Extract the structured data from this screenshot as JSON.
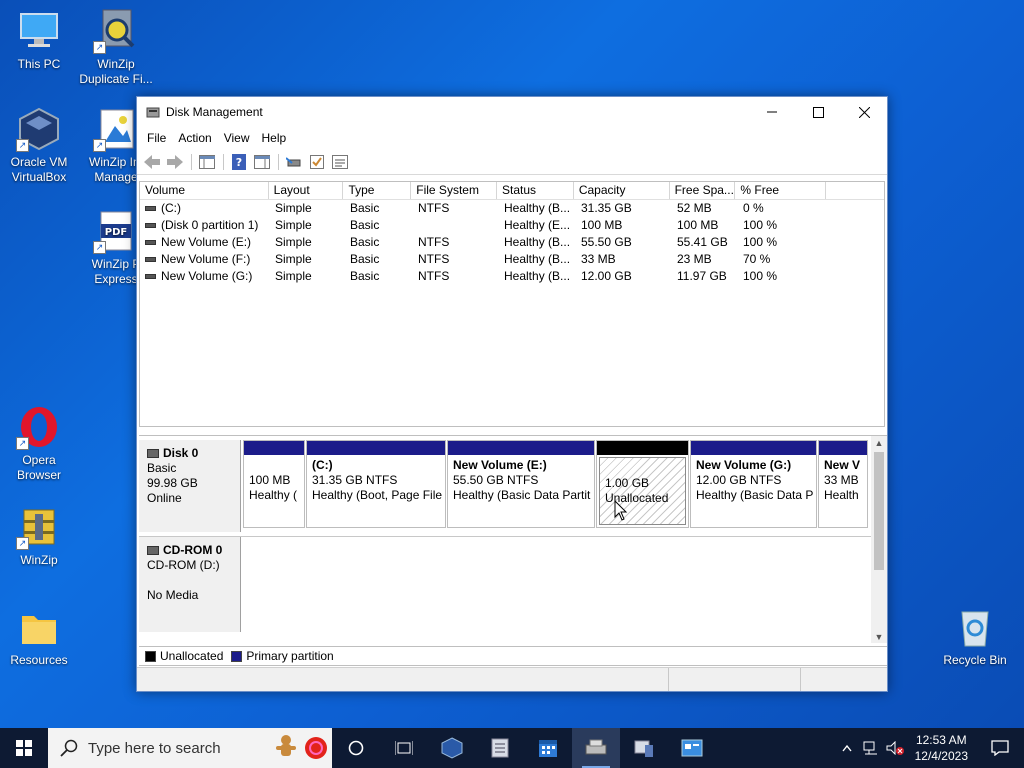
{
  "desktop": {
    "icons": [
      {
        "label": "This PC"
      },
      {
        "label": "WinZip Duplicate Fi..."
      },
      {
        "label": "Oracle VM VirtualBox"
      },
      {
        "label": "WinZip Im Manage"
      },
      {
        "label": "WinZip P Express"
      },
      {
        "label": "Opera Browser"
      },
      {
        "label": "WinZip"
      },
      {
        "label": "Resources"
      },
      {
        "label": "Recycle Bin"
      }
    ]
  },
  "window": {
    "title": "Disk Management",
    "menu": [
      "File",
      "Action",
      "View",
      "Help"
    ]
  },
  "list": {
    "columns": [
      "Volume",
      "Layout",
      "Type",
      "File System",
      "Status",
      "Capacity",
      "Free Spa...",
      "% Free"
    ],
    "rows": [
      [
        "(C:)",
        "Simple",
        "Basic",
        "NTFS",
        "Healthy (B...",
        "31.35 GB",
        "52 MB",
        "0 %"
      ],
      [
        "(Disk 0 partition 1)",
        "Simple",
        "Basic",
        "",
        "Healthy (E...",
        "100 MB",
        "100 MB",
        "100 %"
      ],
      [
        "New Volume (E:)",
        "Simple",
        "Basic",
        "NTFS",
        "Healthy (B...",
        "55.50 GB",
        "55.41 GB",
        "100 %"
      ],
      [
        "New Volume (F:)",
        "Simple",
        "Basic",
        "NTFS",
        "Healthy (B...",
        "33 MB",
        "23 MB",
        "70 %"
      ],
      [
        "New Volume (G:)",
        "Simple",
        "Basic",
        "NTFS",
        "Healthy (B...",
        "12.00 GB",
        "11.97 GB",
        "100 %"
      ]
    ]
  },
  "disk0": {
    "name": "Disk 0",
    "type": "Basic",
    "size": "99.98 GB",
    "state": "Online",
    "partitions": [
      {
        "name": "",
        "size": "100 MB",
        "status": "Healthy (",
        "cap": "primary"
      },
      {
        "name": "(C:)",
        "size": "31.35 GB NTFS",
        "status": "Healthy (Boot, Page File",
        "cap": "primary"
      },
      {
        "name": "New Volume  (E:)",
        "size": "55.50 GB NTFS",
        "status": "Healthy (Basic Data Partit",
        "cap": "primary"
      },
      {
        "name": "",
        "size": "1.00 GB",
        "status": "Unallocated",
        "cap": "unallocated"
      },
      {
        "name": "New Volume  (G:)",
        "size": "12.00 GB NTFS",
        "status": "Healthy (Basic Data P",
        "cap": "primary"
      },
      {
        "name": "New V",
        "size": "33 MB",
        "status": "Health",
        "cap": "primary"
      }
    ]
  },
  "cdrom0": {
    "name": "CD-ROM 0",
    "drive": "CD-ROM (D:)",
    "state": "No Media"
  },
  "legend": {
    "unallocated": "Unallocated",
    "primary": "Primary partition"
  },
  "colors": {
    "primary": "#1c1c8a",
    "unallocated": "#000000"
  },
  "taskbar": {
    "search_placeholder": "Type here to search",
    "time": "12:53 AM",
    "date": "12/4/2023"
  }
}
